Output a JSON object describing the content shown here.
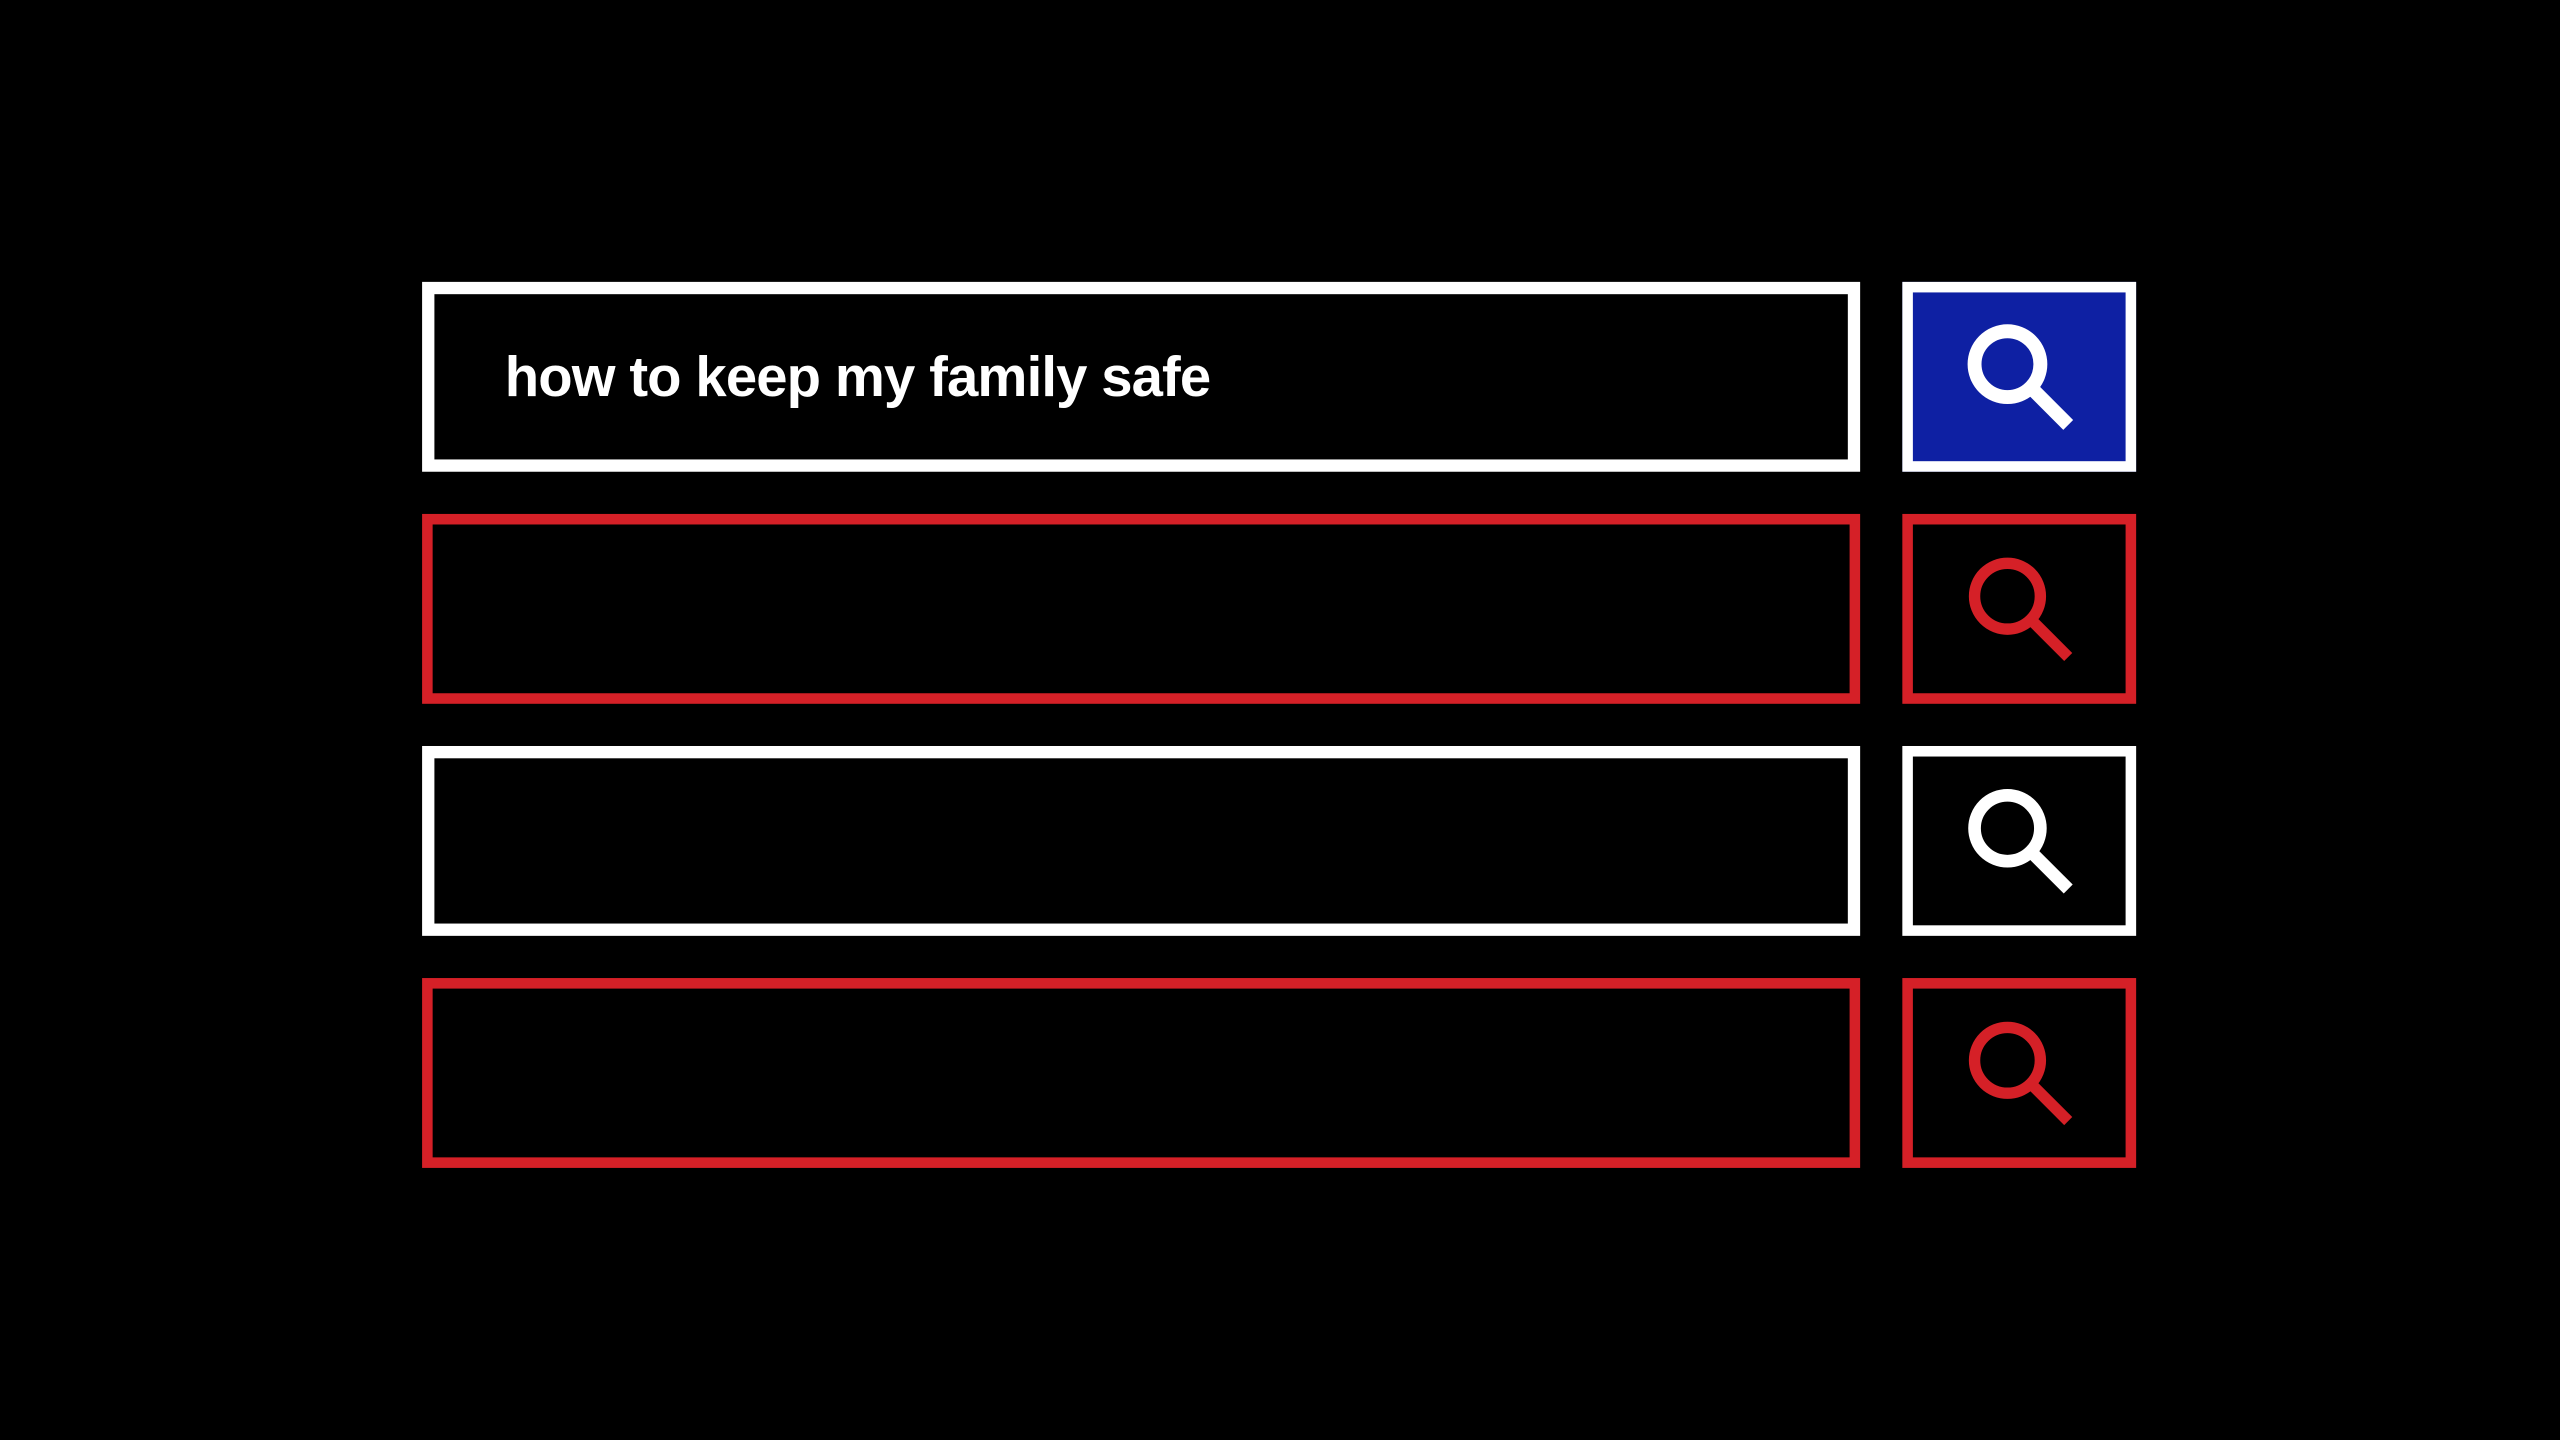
{
  "rows": [
    {
      "text": "how to keep my family safe",
      "box_variant": "white",
      "btn_variant": "blue",
      "icon_color": "#ffffff",
      "icon_stroke": "11"
    },
    {
      "text": "",
      "box_variant": "red",
      "btn_variant": "red",
      "icon_color": "#d52027",
      "icon_stroke": "9"
    },
    {
      "text": "",
      "box_variant": "white",
      "btn_variant": "white",
      "icon_color": "#ffffff",
      "icon_stroke": "10"
    },
    {
      "text": "",
      "box_variant": "red",
      "btn_variant": "red",
      "icon_color": "#d52027",
      "icon_stroke": "9"
    }
  ],
  "colors": {
    "background": "#000000",
    "white": "#ffffff",
    "red": "#d52027",
    "blue": "#0e20a3"
  }
}
